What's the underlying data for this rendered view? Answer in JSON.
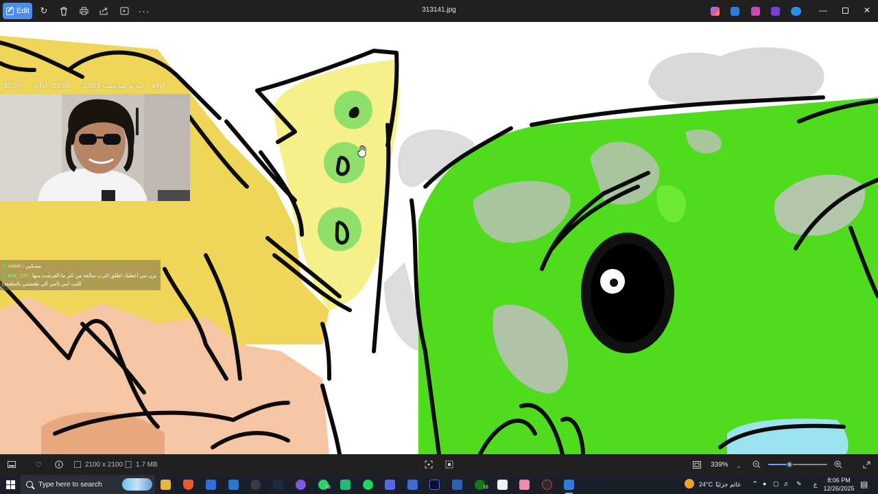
{
  "window": {
    "title": "313141.jpg"
  },
  "toolbar": {
    "edit_label": "Edit",
    "icons": [
      "rotate-icon",
      "delete-icon",
      "print-icon",
      "share-icon",
      "slideshow-icon",
      "more-icon"
    ]
  },
  "stream_overlay": {
    "donations": [
      "$5.00",
      "a4yl",
      "$5.00",
      "2.00$",
      "عيد تو عيد ننننت",
      "a4yl"
    ],
    "chat": [
      {
        "user": "zvbsh",
        "message": "مسكين"
      },
      {
        "user": "end_120",
        "message": "يزن تبي اعطيك اطلق اغرب سالفة من كثر ما الفرشت منها"
      },
      {
        "user": "",
        "message": "كلبت امي (امي الي طعمتني بالملعقة)"
      }
    ]
  },
  "statusbar": {
    "dimensions": "2100 x 2100",
    "file_size": "1.7 MB",
    "zoom": "339%",
    "zoom_level": 0.36
  },
  "taskbar": {
    "search_placeholder": "Type here to search",
    "whatsapp_badge": "18",
    "xbox_badge": "16",
    "weather": "24°C",
    "weather_desc": "غائم جزئيًا",
    "lang": "ع",
    "time": "8:06 PM",
    "date": "12/26/2025"
  }
}
